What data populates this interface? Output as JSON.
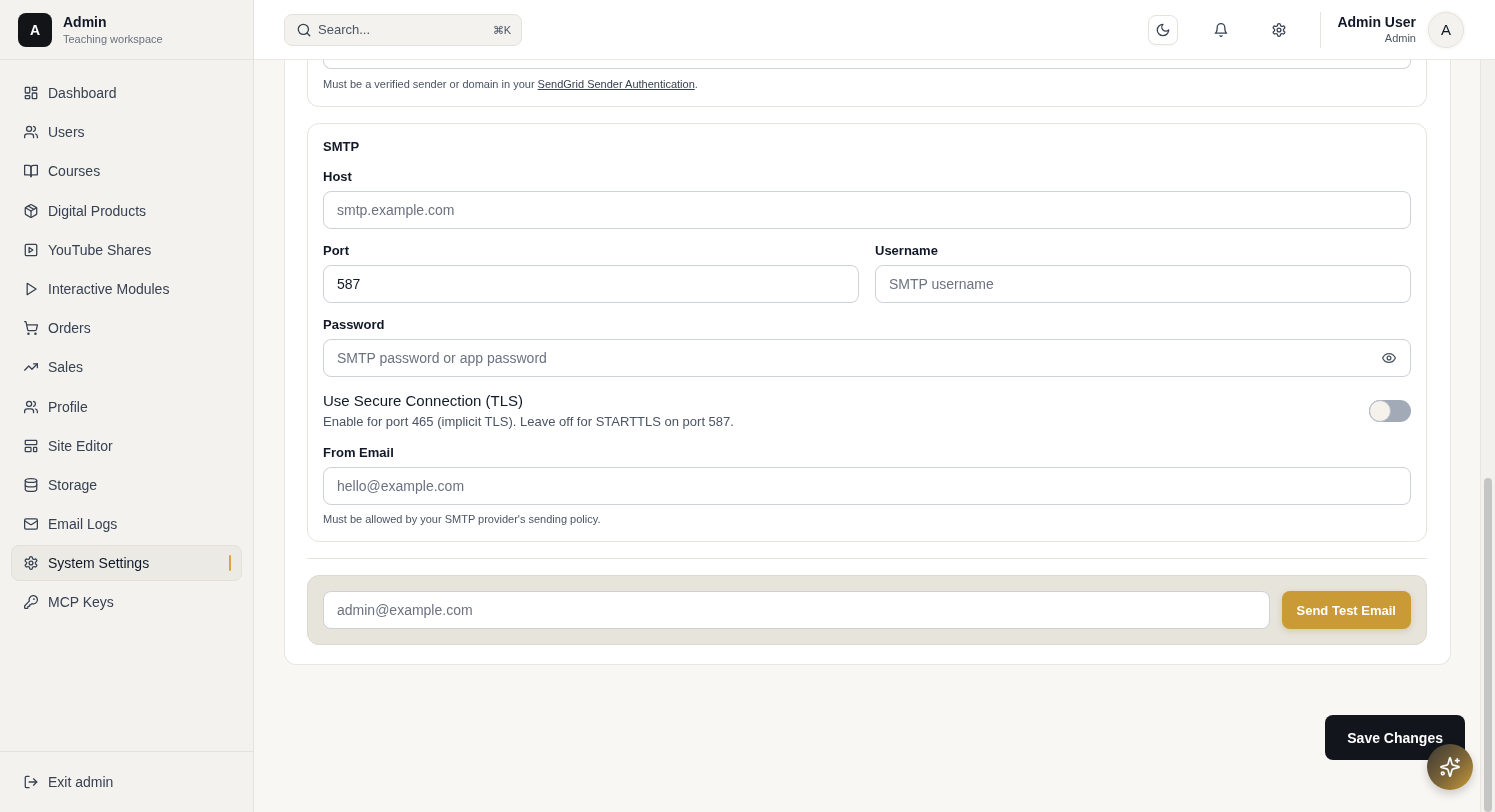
{
  "sidebar": {
    "brand": {
      "initial": "A",
      "title": "Admin",
      "subtitle": "Teaching workspace"
    },
    "items": [
      {
        "label": "Dashboard",
        "selected": false
      },
      {
        "label": "Users",
        "selected": false
      },
      {
        "label": "Courses",
        "selected": false
      },
      {
        "label": "Digital Products",
        "selected": false
      },
      {
        "label": "YouTube Shares",
        "selected": false
      },
      {
        "label": "Interactive Modules",
        "selected": false
      },
      {
        "label": "Orders",
        "selected": false
      },
      {
        "label": "Sales",
        "selected": false
      },
      {
        "label": "Profile",
        "selected": false
      },
      {
        "label": "Site Editor",
        "selected": false
      },
      {
        "label": "Storage",
        "selected": false
      },
      {
        "label": "Email Logs",
        "selected": false
      },
      {
        "label": "System Settings",
        "selected": true
      },
      {
        "label": "MCP Keys",
        "selected": false
      }
    ],
    "footer": {
      "label": "Exit admin"
    }
  },
  "topbar": {
    "search": {
      "placeholder": "Search...",
      "shortcut": "⌘K"
    },
    "user": {
      "name": "Admin User",
      "role": "Admin",
      "initial": "A"
    }
  },
  "sendgrid": {
    "note": "Must be a verified sender or domain in your ",
    "link": "SendGrid Sender Authentication",
    "note_end": "."
  },
  "smtp": {
    "title": "SMTP",
    "rows": [
      {
        "kind": "fields",
        "fields": [
          {
            "kind": "text",
            "label": "Host",
            "placeholder": "smtp.example.com"
          }
        ]
      },
      {
        "kind": "fields",
        "fields": [
          {
            "kind": "text",
            "label": "Port",
            "value": "587"
          },
          {
            "kind": "text",
            "label": "Username",
            "placeholder": "SMTP username"
          }
        ]
      },
      {
        "kind": "fields",
        "fields": [
          {
            "kind": "password",
            "label": "Password",
            "placeholder": "SMTP password or app password"
          }
        ]
      },
      {
        "kind": "toggle",
        "title": "Use Secure Connection (TLS)",
        "description": "Enable for port 465 (implicit TLS). Leave off for STARTTLS on port 587.",
        "on": false
      },
      {
        "kind": "fields",
        "fields": [
          {
            "kind": "text",
            "label": "From Email",
            "placeholder": "hello@example.com",
            "note": "Must be allowed by your SMTP provider's sending policy."
          }
        ]
      }
    ]
  },
  "test_email": {
    "placeholder": "admin@example.com",
    "button": "Send Test Email"
  },
  "save_button": "Save Changes"
}
